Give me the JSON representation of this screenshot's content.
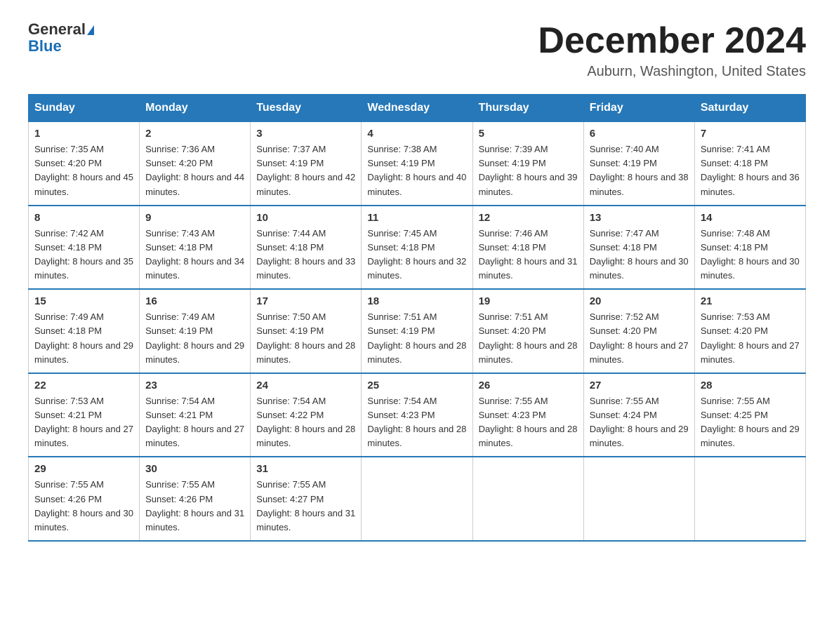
{
  "header": {
    "logo_line1": "General",
    "logo_line2": "Blue",
    "month_title": "December 2024",
    "location": "Auburn, Washington, United States"
  },
  "days_of_week": [
    "Sunday",
    "Monday",
    "Tuesday",
    "Wednesday",
    "Thursday",
    "Friday",
    "Saturday"
  ],
  "weeks": [
    [
      {
        "day": "1",
        "sunrise": "7:35 AM",
        "sunset": "4:20 PM",
        "daylight": "8 hours and 45 minutes."
      },
      {
        "day": "2",
        "sunrise": "7:36 AM",
        "sunset": "4:20 PM",
        "daylight": "8 hours and 44 minutes."
      },
      {
        "day": "3",
        "sunrise": "7:37 AM",
        "sunset": "4:19 PM",
        "daylight": "8 hours and 42 minutes."
      },
      {
        "day": "4",
        "sunrise": "7:38 AM",
        "sunset": "4:19 PM",
        "daylight": "8 hours and 40 minutes."
      },
      {
        "day": "5",
        "sunrise": "7:39 AM",
        "sunset": "4:19 PM",
        "daylight": "8 hours and 39 minutes."
      },
      {
        "day": "6",
        "sunrise": "7:40 AM",
        "sunset": "4:19 PM",
        "daylight": "8 hours and 38 minutes."
      },
      {
        "day": "7",
        "sunrise": "7:41 AM",
        "sunset": "4:18 PM",
        "daylight": "8 hours and 36 minutes."
      }
    ],
    [
      {
        "day": "8",
        "sunrise": "7:42 AM",
        "sunset": "4:18 PM",
        "daylight": "8 hours and 35 minutes."
      },
      {
        "day": "9",
        "sunrise": "7:43 AM",
        "sunset": "4:18 PM",
        "daylight": "8 hours and 34 minutes."
      },
      {
        "day": "10",
        "sunrise": "7:44 AM",
        "sunset": "4:18 PM",
        "daylight": "8 hours and 33 minutes."
      },
      {
        "day": "11",
        "sunrise": "7:45 AM",
        "sunset": "4:18 PM",
        "daylight": "8 hours and 32 minutes."
      },
      {
        "day": "12",
        "sunrise": "7:46 AM",
        "sunset": "4:18 PM",
        "daylight": "8 hours and 31 minutes."
      },
      {
        "day": "13",
        "sunrise": "7:47 AM",
        "sunset": "4:18 PM",
        "daylight": "8 hours and 30 minutes."
      },
      {
        "day": "14",
        "sunrise": "7:48 AM",
        "sunset": "4:18 PM",
        "daylight": "8 hours and 30 minutes."
      }
    ],
    [
      {
        "day": "15",
        "sunrise": "7:49 AM",
        "sunset": "4:18 PM",
        "daylight": "8 hours and 29 minutes."
      },
      {
        "day": "16",
        "sunrise": "7:49 AM",
        "sunset": "4:19 PM",
        "daylight": "8 hours and 29 minutes."
      },
      {
        "day": "17",
        "sunrise": "7:50 AM",
        "sunset": "4:19 PM",
        "daylight": "8 hours and 28 minutes."
      },
      {
        "day": "18",
        "sunrise": "7:51 AM",
        "sunset": "4:19 PM",
        "daylight": "8 hours and 28 minutes."
      },
      {
        "day": "19",
        "sunrise": "7:51 AM",
        "sunset": "4:20 PM",
        "daylight": "8 hours and 28 minutes."
      },
      {
        "day": "20",
        "sunrise": "7:52 AM",
        "sunset": "4:20 PM",
        "daylight": "8 hours and 27 minutes."
      },
      {
        "day": "21",
        "sunrise": "7:53 AM",
        "sunset": "4:20 PM",
        "daylight": "8 hours and 27 minutes."
      }
    ],
    [
      {
        "day": "22",
        "sunrise": "7:53 AM",
        "sunset": "4:21 PM",
        "daylight": "8 hours and 27 minutes."
      },
      {
        "day": "23",
        "sunrise": "7:54 AM",
        "sunset": "4:21 PM",
        "daylight": "8 hours and 27 minutes."
      },
      {
        "day": "24",
        "sunrise": "7:54 AM",
        "sunset": "4:22 PM",
        "daylight": "8 hours and 28 minutes."
      },
      {
        "day": "25",
        "sunrise": "7:54 AM",
        "sunset": "4:23 PM",
        "daylight": "8 hours and 28 minutes."
      },
      {
        "day": "26",
        "sunrise": "7:55 AM",
        "sunset": "4:23 PM",
        "daylight": "8 hours and 28 minutes."
      },
      {
        "day": "27",
        "sunrise": "7:55 AM",
        "sunset": "4:24 PM",
        "daylight": "8 hours and 29 minutes."
      },
      {
        "day": "28",
        "sunrise": "7:55 AM",
        "sunset": "4:25 PM",
        "daylight": "8 hours and 29 minutes."
      }
    ],
    [
      {
        "day": "29",
        "sunrise": "7:55 AM",
        "sunset": "4:26 PM",
        "daylight": "8 hours and 30 minutes."
      },
      {
        "day": "30",
        "sunrise": "7:55 AM",
        "sunset": "4:26 PM",
        "daylight": "8 hours and 31 minutes."
      },
      {
        "day": "31",
        "sunrise": "7:55 AM",
        "sunset": "4:27 PM",
        "daylight": "8 hours and 31 minutes."
      },
      null,
      null,
      null,
      null
    ]
  ]
}
